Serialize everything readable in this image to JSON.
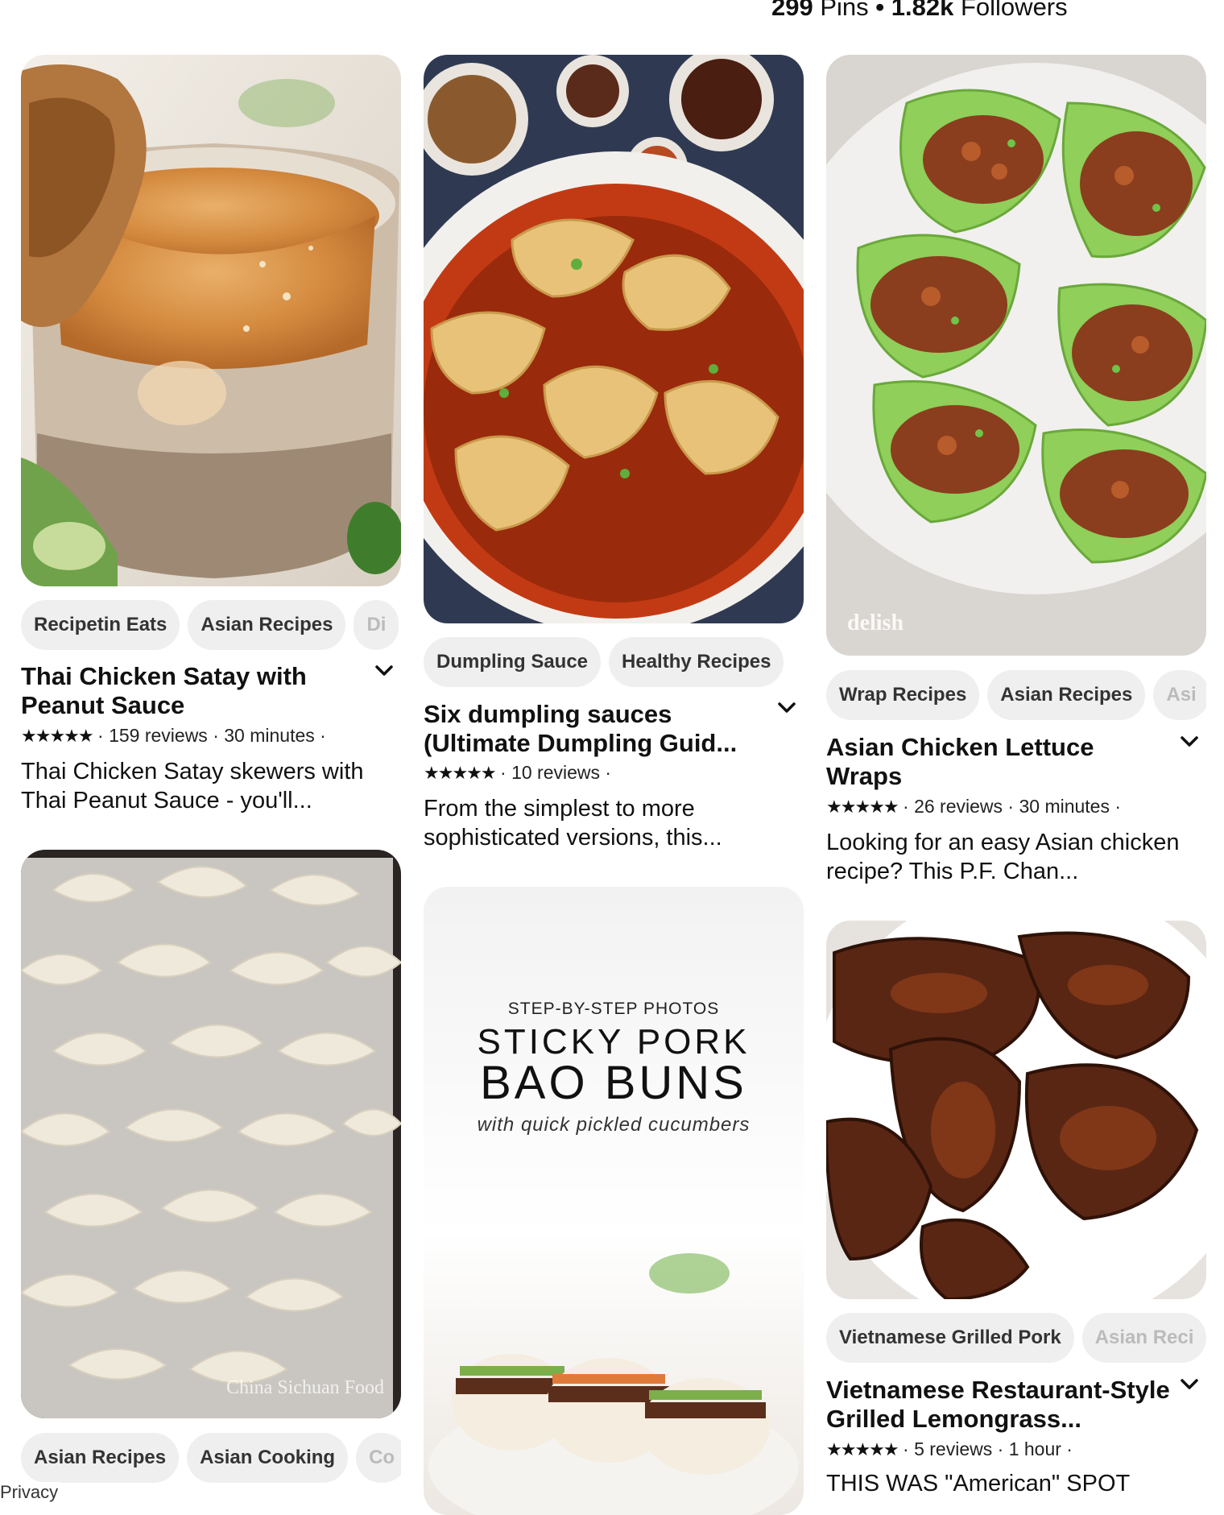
{
  "header": {
    "pins_count": "299",
    "pins_label": "Pins",
    "separator": "•",
    "followers_count": "1.82k",
    "followers_label": "Followers"
  },
  "pins": [
    {
      "chips": [
        "Recipetin Eats",
        "Asian Recipes",
        "Di"
      ],
      "title": "Thai Chicken Satay with Peanut Sauce",
      "stars": "★★★★★",
      "reviews": "159 reviews",
      "time": "30 minutes",
      "description": "Thai Chicken Satay skewers with Thai Peanut Sauce - you'll..."
    },
    {
      "chips": [
        "Asian Recipes",
        "Asian Cooking",
        "Co"
      ],
      "watermark": "China Sichuan Food"
    },
    {
      "chips": [
        "Dumpling Sauce",
        "Healthy Recipes"
      ],
      "title": "Six dumpling sauces (Ultimate Dumpling Guid...",
      "stars": "★★★★★",
      "reviews": "10 reviews",
      "description": "From the simplest to more sophisticated versions, this..."
    },
    {
      "overlay_kicker": "STEP-BY-STEP PHOTOS",
      "overlay_line1": "STICKY PORK",
      "overlay_line2": "BAO BUNS",
      "overlay_sub": "with quick pickled cucumbers"
    },
    {
      "chips": [
        "Wrap Recipes",
        "Asian Recipes",
        "Asi"
      ],
      "watermark": "delish",
      "title": "Asian Chicken Lettuce Wraps",
      "stars": "★★★★★",
      "reviews": "26 reviews",
      "time": "30 minutes",
      "description": "Looking for an easy Asian chicken recipe? This P.F. Chan..."
    },
    {
      "chips": [
        "Vietnamese Grilled Pork",
        "Asian Reci"
      ],
      "title": "Vietnamese Restaurant-Style Grilled Lemongrass...",
      "stars": "★★★★★",
      "reviews": "5 reviews",
      "time": "1 hour",
      "description": "THIS WAS \"American\" SPOT"
    }
  ],
  "footer": {
    "privacy": "Privacy"
  },
  "colors": {
    "chip_bg": "#efefef",
    "text": "#111111"
  }
}
